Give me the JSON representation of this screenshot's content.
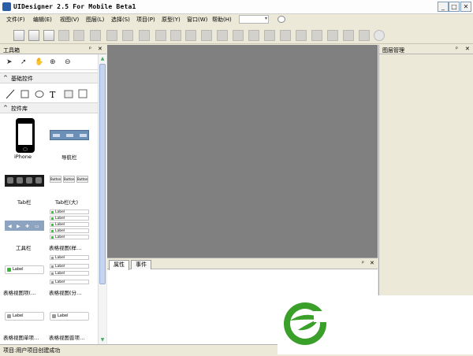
{
  "window": {
    "title": "UIDesigner 2.5 For Mobile Beta1",
    "controls": {
      "minimize": "_",
      "maximize": "□",
      "close": "✕"
    }
  },
  "menu": [
    {
      "label": "文件(F)"
    },
    {
      "label": "编辑(E)"
    },
    {
      "label": "视图(V)"
    },
    {
      "label": "图层(L)"
    },
    {
      "label": "选择(S)"
    },
    {
      "label": "项目(P)"
    },
    {
      "label": "原型(Y)"
    },
    {
      "label": "窗口(W)"
    },
    {
      "label": "帮助(H)"
    }
  ],
  "zoom": {
    "arrow": "▾"
  },
  "toolbox": {
    "title": "工具箱",
    "pin": "ᵖ",
    "close": "✕",
    "tools": [
      "select-arrow-icon",
      "direct-select-icon",
      "hand-icon",
      "zoom-in-icon",
      "zoom-out-icon"
    ],
    "sections": {
      "basic": "基础控件",
      "library": "控件库"
    },
    "chevron": "^",
    "controls": [
      {
        "label": "iPhone"
      },
      {
        "label": "导航栏"
      },
      {
        "label": "Tab栏"
      },
      {
        "label": "Tab栏(大)"
      },
      {
        "label": "工具栏"
      },
      {
        "label": "表格视图(样…"
      },
      {
        "label": "表格视图项(…"
      },
      {
        "label": "表格视图(分…"
      },
      {
        "label": "表格视图单项…"
      },
      {
        "label": "表格视图普项…"
      }
    ],
    "button_text": "Button",
    "cell_label": "Label"
  },
  "layers": {
    "title": "图层管理",
    "pin": "ᵖ",
    "close": "✕"
  },
  "bottom": {
    "tabs": [
      {
        "label": "属性"
      },
      {
        "label": "事件"
      }
    ],
    "pin": "ᵖ",
    "close": "✕"
  },
  "status": {
    "text": "项目:用户项目创建成功"
  },
  "colors": {
    "canvas": "#808080",
    "logo_green": "#3aa02a",
    "tab_active": "#ffffff"
  }
}
